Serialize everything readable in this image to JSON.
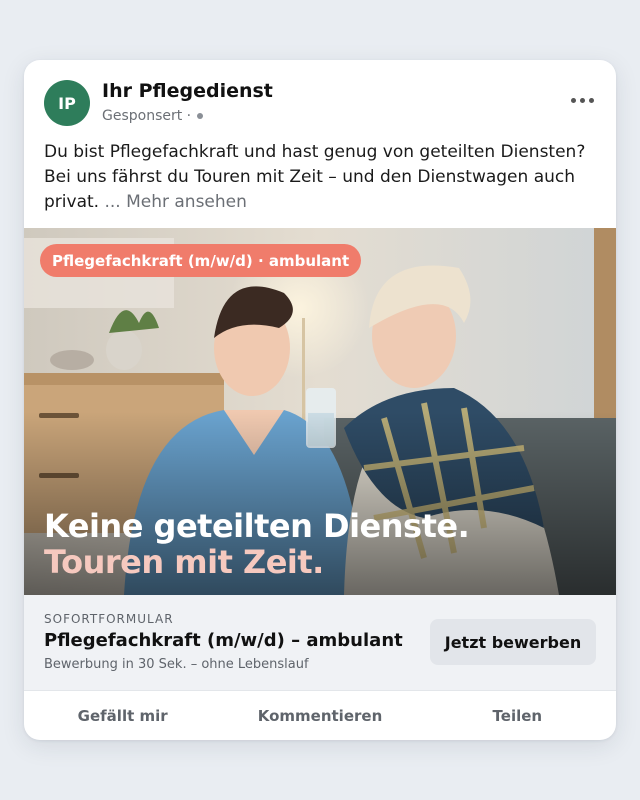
{
  "post": {
    "avatar_initials": "IP",
    "avatar_color": "#2e7d5b",
    "page_name": "Ihr Pflegedienst",
    "sponsored_label": "Gesponsert ·",
    "text": "Du bist Pflegefachkraft und hast genug von geteilten Diensten? Bei uns fährst du Touren mit Zeit – und den Dienstwagen auch privat. ",
    "see_more": "... Mehr ansehen"
  },
  "media": {
    "tag": "Pflegefachkraft (m/w/d) · ambulant",
    "tag_color": "#f07c6b",
    "headline_line1": "Keine geteilten Dienste.",
    "headline_line2": "Touren mit Zeit.",
    "headline_accent": "#f6c9bf"
  },
  "cta": {
    "kicker": "SOFORTFORMULAR",
    "title": "Pflegefachkraft (m/w/d) – ambulant",
    "subtitle": "Bewerbung in 30 Sek. – ohne Lebenslauf",
    "button_label": "Jetzt bewerben"
  },
  "actions": {
    "like": "Gefällt mir",
    "comment": "Kommentieren",
    "share": "Teilen"
  }
}
